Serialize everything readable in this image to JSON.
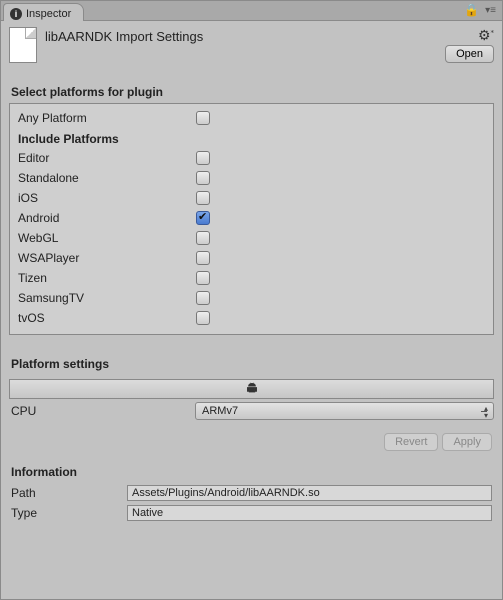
{
  "tab": {
    "label": "Inspector"
  },
  "header": {
    "title": "libAARNDK Import Settings",
    "open_label": "Open"
  },
  "platforms": {
    "section_title": "Select platforms for plugin",
    "any_platform_label": "Any Platform",
    "any_platform_checked": false,
    "include_header": "Include Platforms",
    "items": [
      {
        "label": "Editor",
        "checked": false
      },
      {
        "label": "Standalone",
        "checked": false
      },
      {
        "label": "iOS",
        "checked": false
      },
      {
        "label": "Android",
        "checked": true
      },
      {
        "label": "WebGL",
        "checked": false
      },
      {
        "label": "WSAPlayer",
        "checked": false
      },
      {
        "label": "Tizen",
        "checked": false
      },
      {
        "label": "SamsungTV",
        "checked": false
      },
      {
        "label": "tvOS",
        "checked": false
      }
    ]
  },
  "platform_settings": {
    "section_title": "Platform settings",
    "active_platform_icon": "android-icon",
    "cpu_label": "CPU",
    "cpu_value": "ARMv7"
  },
  "buttons": {
    "revert": "Revert",
    "apply": "Apply"
  },
  "information": {
    "section_title": "Information",
    "path_label": "Path",
    "path_value": "Assets/Plugins/Android/libAARNDK.so",
    "type_label": "Type",
    "type_value": "Native"
  }
}
